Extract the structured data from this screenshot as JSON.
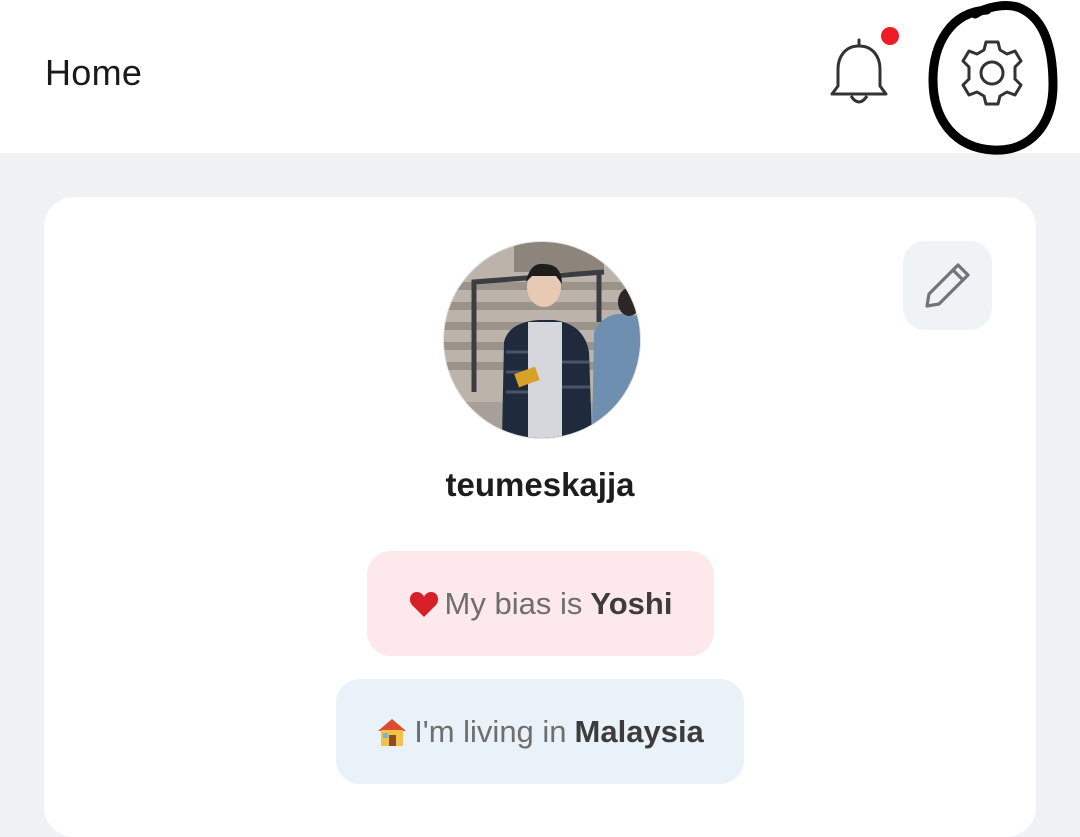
{
  "header": {
    "title": "Home",
    "icons": [
      "bell-icon",
      "gear-icon"
    ],
    "notification_dot_color": "#ee1c25",
    "annotation": "hand-drawn black circle around settings gear"
  },
  "profile": {
    "username": "teumeskajja",
    "avatar": "profile-photo",
    "edit_icon": "pencil-icon"
  },
  "chips": {
    "bias": {
      "emoji": "heart-icon",
      "prefix": "My bias is",
      "value": "Yoshi",
      "bg": "#fde8eb"
    },
    "home": {
      "emoji": "house-icon",
      "prefix": "I'm living in",
      "value": "Malaysia",
      "bg": "#e9f2f9"
    }
  }
}
